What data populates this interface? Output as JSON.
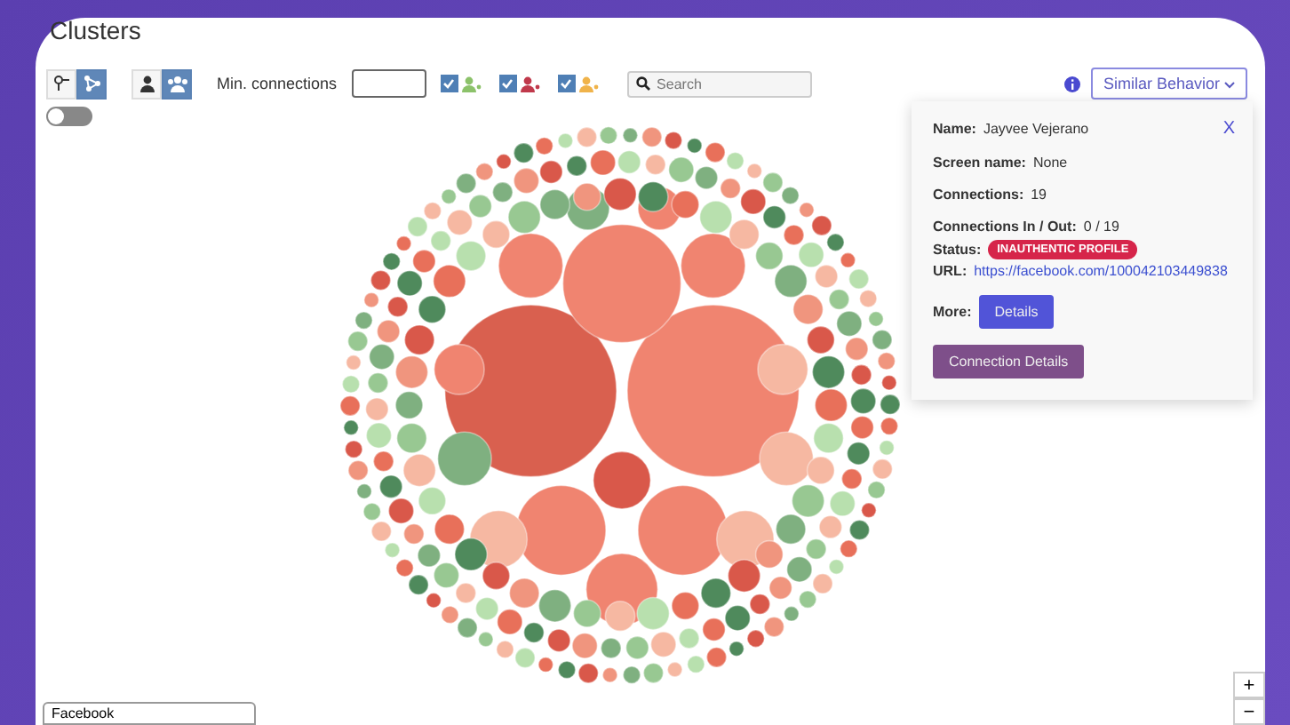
{
  "title": "Clusters",
  "view_toggle": [
    {
      "kind": "graph",
      "selected": false
    },
    {
      "kind": "cluster",
      "selected": true
    }
  ],
  "mode_toggle": [
    {
      "kind": "person",
      "selected": false
    },
    {
      "kind": "group",
      "selected": true
    }
  ],
  "min_connections": {
    "label": "Min. connections"
  },
  "filters": [
    {
      "color": "#8cc26a",
      "checked": true
    },
    {
      "color": "#c0394b",
      "checked": true
    },
    {
      "color": "#f0b34a",
      "checked": true
    }
  ],
  "search": {
    "placeholder": "Search"
  },
  "behavior_dropdown": {
    "label": "Similar Behavior"
  },
  "switch": {
    "on": false
  },
  "details_panel": {
    "close": "X",
    "fields": [
      {
        "label": "Name:",
        "value": "Jayvee Vejerano"
      },
      {
        "label": "Screen name:",
        "value": "None"
      },
      {
        "label": "Connections:",
        "value": "19"
      },
      {
        "label": "Connections In / Out:",
        "value": "0 / 19"
      }
    ],
    "status_label": "Status:",
    "status": "INAUTHENTIC PROFILE",
    "url_label": "URL:",
    "url": "https://facebook.com/100042103449838",
    "more_label": "More:",
    "details_button": "Details",
    "connection_button": "Connection Details"
  },
  "platform_select": {
    "value": "Facebook"
  },
  "zoom": {
    "in": "+",
    "out": "−"
  }
}
